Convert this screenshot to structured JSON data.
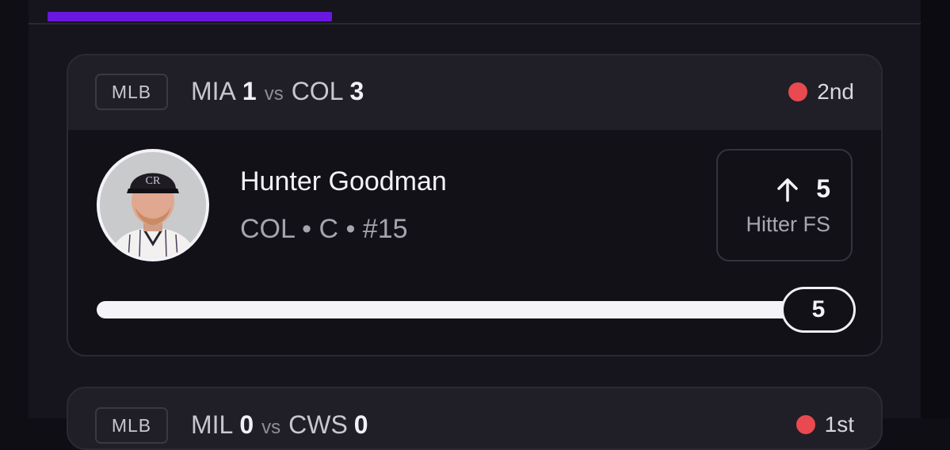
{
  "game": {
    "league": "MLB",
    "away_team": "MIA",
    "away_score": "1",
    "vs_label": "vs",
    "home_team": "COL",
    "home_score": "3",
    "inning": "2nd",
    "live_color": "#e84a4f"
  },
  "player": {
    "name": "Hunter Goodman",
    "meta": "COL • C • #15",
    "photo_icon": "player-headshot"
  },
  "stat": {
    "direction_icon": "arrow-up-icon",
    "value": "5",
    "label": "Hitter FS"
  },
  "progress": {
    "value": "5",
    "fill_fraction": 1.0
  },
  "next_game": {
    "league": "MLB",
    "away_team": "MIL",
    "away_score": "0",
    "vs_label": "vs",
    "home_team": "CWS",
    "home_score": "0",
    "inning": "1st"
  },
  "colors": {
    "accent": "#6a17e0",
    "background": "#0f0e15",
    "card": "#121118",
    "header": "#201f27"
  }
}
